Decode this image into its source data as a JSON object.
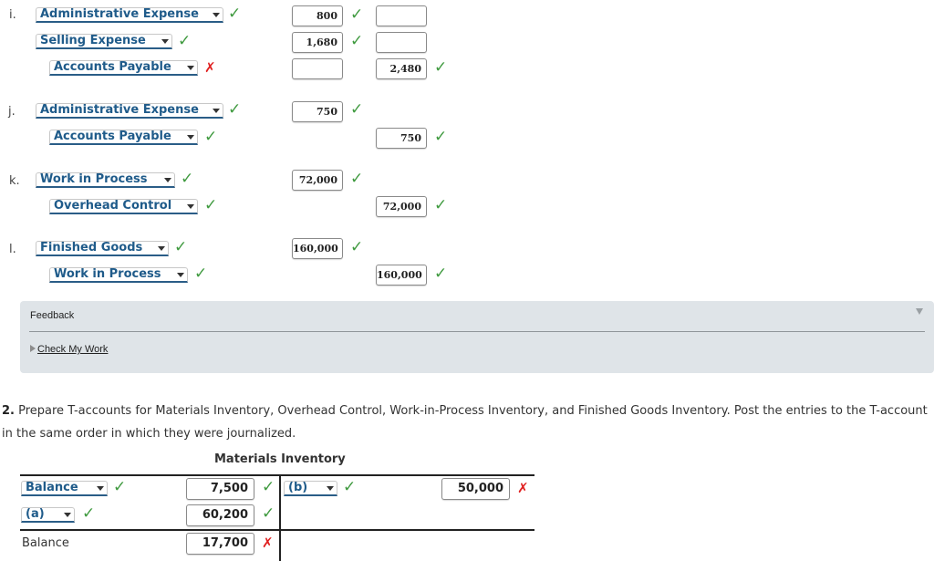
{
  "journal": {
    "entries": [
      {
        "letter": "i.",
        "lines": [
          {
            "account": "Administrative Expense",
            "account_status": "correct",
            "debit": "800",
            "debit_status": "correct",
            "credit": "",
            "credit_status": ""
          },
          {
            "account": "Selling Expense",
            "account_status": "correct",
            "debit": "1,680",
            "debit_status": "correct",
            "credit": "",
            "credit_status": ""
          },
          {
            "account": "Accounts Payable",
            "account_status": "incorrect",
            "debit": "",
            "debit_status": "",
            "credit": "2,480",
            "credit_status": "correct"
          }
        ]
      },
      {
        "letter": "j.",
        "lines": [
          {
            "account": "Administrative Expense",
            "account_status": "correct",
            "debit": "750",
            "debit_status": "correct"
          },
          {
            "account": "Accounts Payable",
            "account_status": "correct",
            "credit": "750",
            "credit_status": "correct"
          }
        ]
      },
      {
        "letter": "k.",
        "lines": [
          {
            "account": "Work in Process",
            "account_status": "correct",
            "debit": "72,000",
            "debit_status": "correct"
          },
          {
            "account": "Overhead Control",
            "account_status": "correct",
            "credit": "72,000",
            "credit_status": "correct"
          }
        ]
      },
      {
        "letter": "l.",
        "lines": [
          {
            "account": "Finished Goods",
            "account_status": "correct",
            "debit": "160,000",
            "debit_status": "correct"
          },
          {
            "account": "Work in Process",
            "account_status": "correct",
            "credit": "160,000",
            "credit_status": "correct"
          }
        ]
      }
    ]
  },
  "feedback": {
    "title": "Feedback",
    "link": "Check My Work"
  },
  "instructions": {
    "number": "2.",
    "text": " Prepare T-accounts for Materials Inventory, Overhead Control, Work-in-Process Inventory, and Finished Goods Inventory. Post the entries to the T-account in the same order in which they were journalized."
  },
  "t_account": {
    "title": "Materials Inventory",
    "debit_rows": [
      {
        "label": "Balance",
        "label_status": "correct",
        "amount": "7,500",
        "amount_status": "correct"
      },
      {
        "label": "(a)",
        "label_status": "correct",
        "amount": "60,200",
        "amount_status": "correct"
      }
    ],
    "credit_rows": [
      {
        "label": "(b)",
        "label_status": "correct",
        "amount": "50,000",
        "amount_status": "incorrect"
      }
    ],
    "balance_label": "Balance",
    "balance_amount": "17,700",
    "balance_status": "incorrect"
  },
  "status_marks": {
    "correct": "✓",
    "incorrect": "✗"
  },
  "colors": {
    "correct": "#3f9a3f",
    "incorrect": "#e02020",
    "select_text": "#1f5b8a",
    "feedback_bg": "#dfe4e8"
  }
}
